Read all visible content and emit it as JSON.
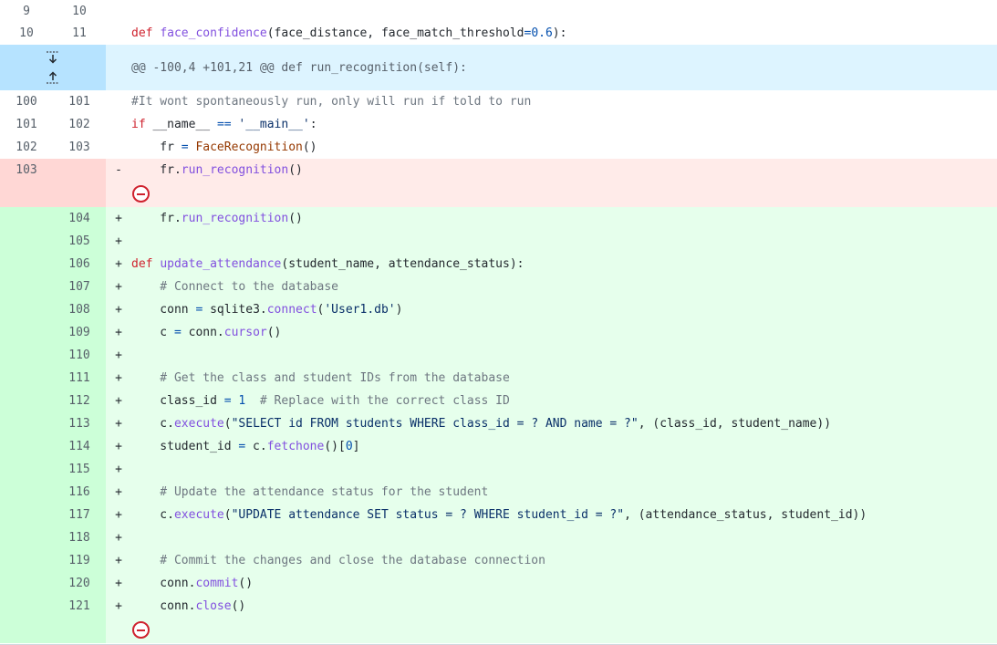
{
  "hunk_header": "@@ -100,4 +101,21 @@ def run_recognition(self):",
  "context_top": [
    {
      "old": "9",
      "new": "10",
      "text": ""
    },
    {
      "old": "10",
      "new": "11",
      "text": "def face_confidence(face_distance, face_match_threshold=0.6):"
    }
  ],
  "context_mid": [
    {
      "old": "100",
      "new": "101",
      "text": "#It wont spontaneously run, only will run if told to run"
    },
    {
      "old": "101",
      "new": "102",
      "text": "if __name__ == '__main__':"
    },
    {
      "old": "102",
      "new": "103",
      "text": "    fr = FaceRecognition()"
    }
  ],
  "deleted": [
    {
      "old": "103",
      "marker": "-",
      "text": "    fr.run_recognition()"
    }
  ],
  "added": [
    {
      "new": "104",
      "marker": "+",
      "text": "    fr.run_recognition()"
    },
    {
      "new": "105",
      "marker": "+",
      "text": ""
    },
    {
      "new": "106",
      "marker": "+",
      "text": "def update_attendance(student_name, attendance_status):"
    },
    {
      "new": "107",
      "marker": "+",
      "text": "    # Connect to the database"
    },
    {
      "new": "108",
      "marker": "+",
      "text": "    conn = sqlite3.connect('User1.db')"
    },
    {
      "new": "109",
      "marker": "+",
      "text": "    c = conn.cursor()"
    },
    {
      "new": "110",
      "marker": "+",
      "text": ""
    },
    {
      "new": "111",
      "marker": "+",
      "text": "    # Get the class and student IDs from the database"
    },
    {
      "new": "112",
      "marker": "+",
      "text": "    class_id = 1  # Replace with the correct class ID"
    },
    {
      "new": "113",
      "marker": "+",
      "text": "    c.execute(\"SELECT id FROM students WHERE class_id = ? AND name = ?\", (class_id, student_name))"
    },
    {
      "new": "114",
      "marker": "+",
      "text": "    student_id = c.fetchone()[0]"
    },
    {
      "new": "115",
      "marker": "+",
      "text": ""
    },
    {
      "new": "116",
      "marker": "+",
      "text": "    # Update the attendance status for the student"
    },
    {
      "new": "117",
      "marker": "+",
      "text": "    c.execute(\"UPDATE attendance SET status = ? WHERE student_id = ?\", (attendance_status, student_id))"
    },
    {
      "new": "118",
      "marker": "+",
      "text": ""
    },
    {
      "new": "119",
      "marker": "+",
      "text": "    # Commit the changes and close the database connection"
    },
    {
      "new": "120",
      "marker": "+",
      "text": "    conn.commit()"
    },
    {
      "new": "121",
      "marker": "+",
      "text": "    conn.close()"
    }
  ]
}
